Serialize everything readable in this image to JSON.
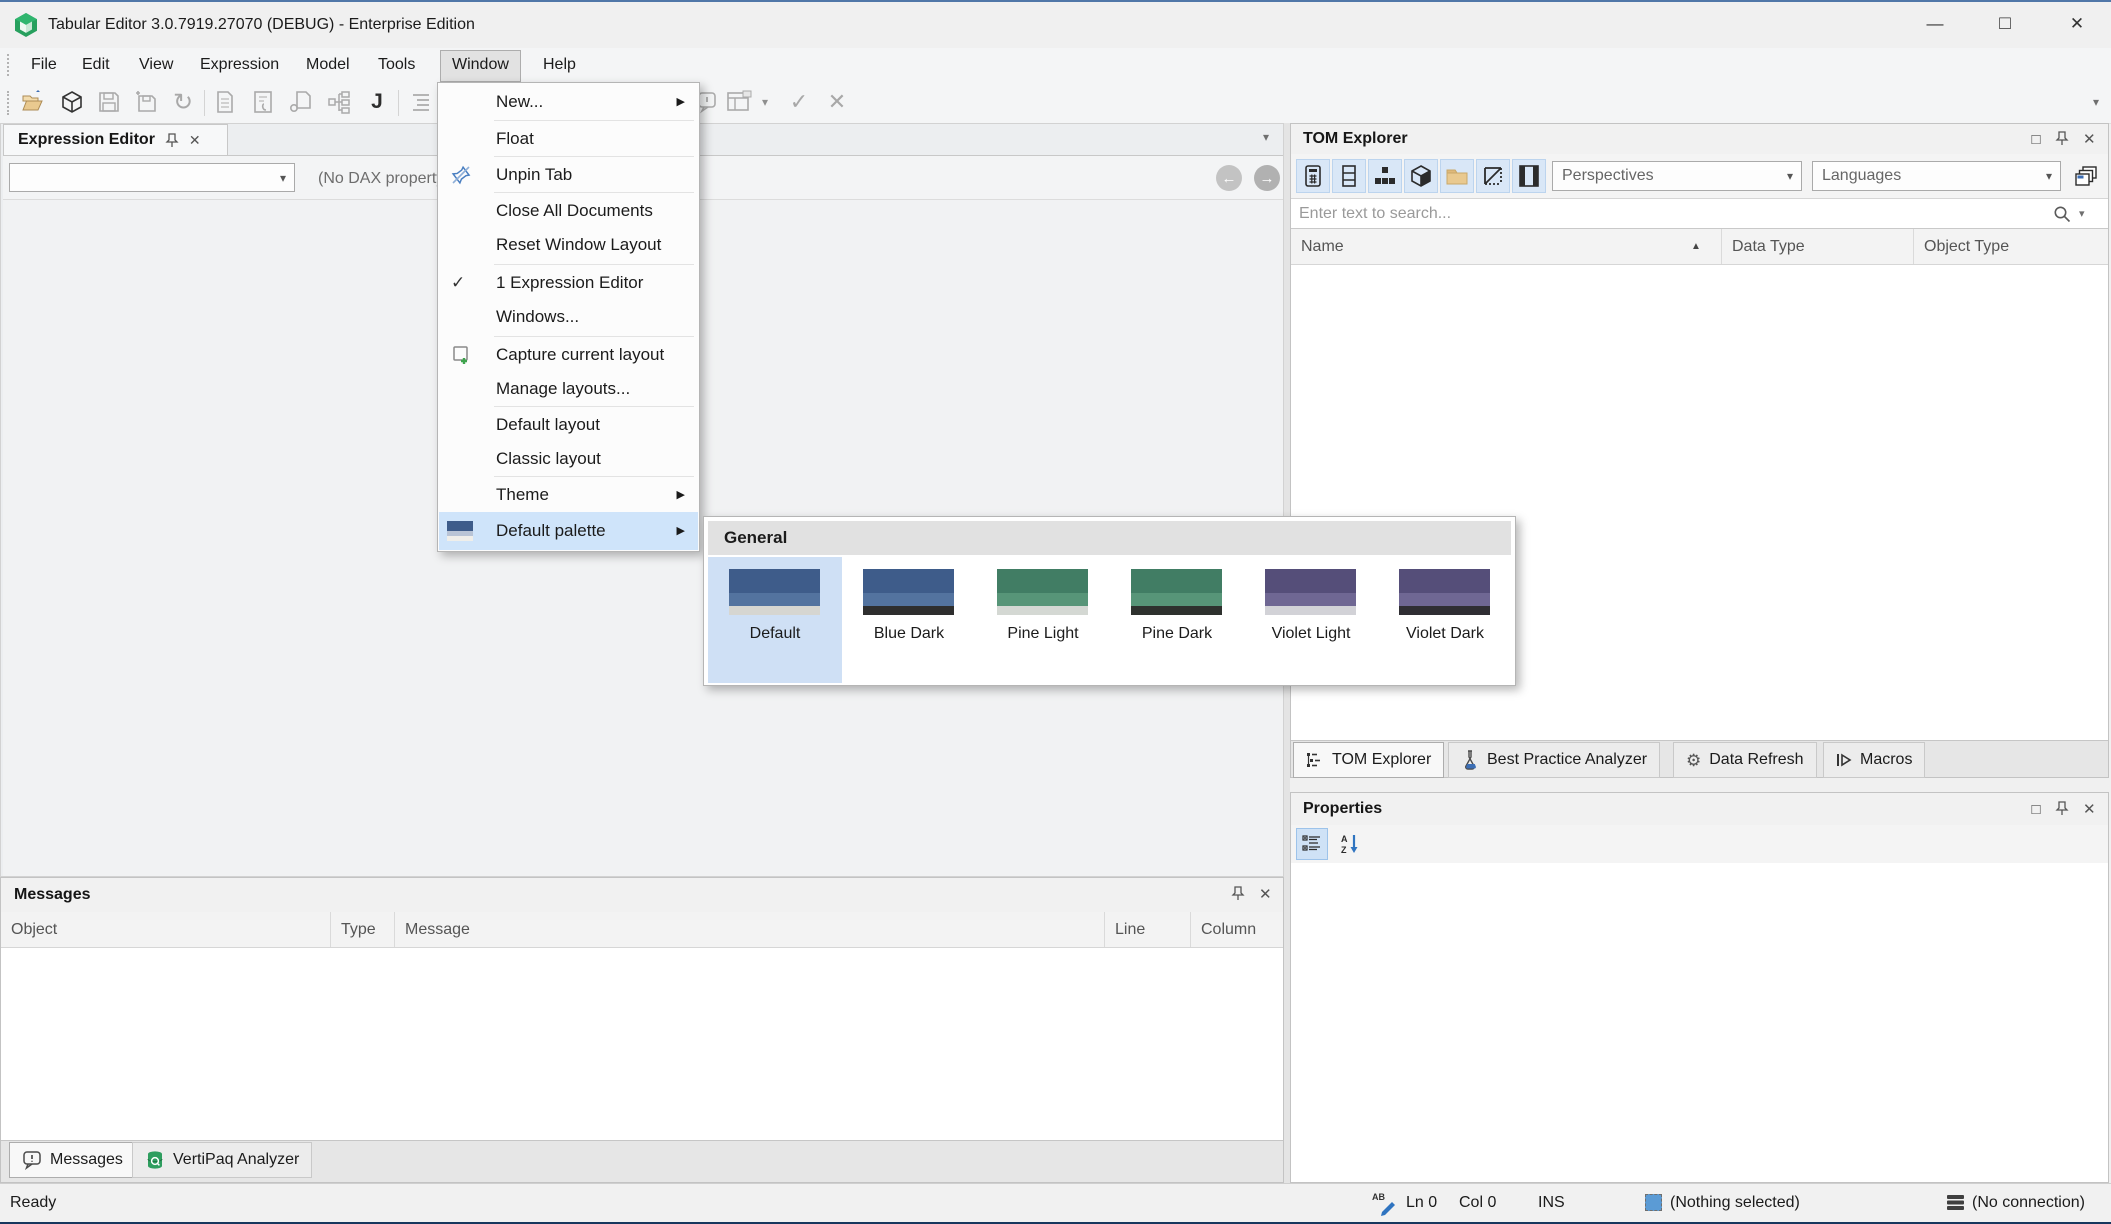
{
  "window": {
    "title": "Tabular Editor 3.0.7919.27070 (DEBUG) - Enterprise Edition"
  },
  "menubar": {
    "items": [
      "File",
      "Edit",
      "View",
      "Expression",
      "Model",
      "Tools",
      "Window",
      "Help"
    ],
    "open_item": "Window"
  },
  "window_menu": {
    "items": [
      {
        "label": "New..."
      },
      {
        "label": "Float"
      },
      {
        "label": "Unpin Tab"
      },
      {
        "label": "Close All Documents"
      },
      {
        "label": "Reset Window Layout"
      },
      {
        "label": "1 Expression Editor"
      },
      {
        "label": "Windows..."
      },
      {
        "label": "Capture current layout"
      },
      {
        "label": "Manage layouts..."
      },
      {
        "label": "Default layout"
      },
      {
        "label": "Classic layout"
      },
      {
        "label": "Theme"
      },
      {
        "label": "Default palette"
      }
    ],
    "highlighted_item": "Default palette",
    "palette_icon_colors": {
      "top": "#3E5C8A",
      "mid": "#B9C4D6",
      "bottom": "#EFEEEA"
    }
  },
  "palette_submenu": {
    "group_label": "General",
    "selected": "Default",
    "items": [
      {
        "label": "Default",
        "colors": {
          "top": "#3E5C8A",
          "mid": "#53739F",
          "bottom": "#D6D6D1"
        }
      },
      {
        "label": "Blue Dark",
        "colors": {
          "top": "#3E5C8A",
          "mid": "#53739F",
          "bottom": "#2E2E2E"
        }
      },
      {
        "label": "Pine Light",
        "colors": {
          "top": "#417D64",
          "mid": "#579578",
          "bottom": "#D4D8D3"
        }
      },
      {
        "label": "Pine Dark",
        "colors": {
          "top": "#417D64",
          "mid": "#579578",
          "bottom": "#2E312E"
        }
      },
      {
        "label": "Violet Light",
        "colors": {
          "top": "#554E79",
          "mid": "#6F6793",
          "bottom": "#D2D2D7"
        }
      },
      {
        "label": "Violet Dark",
        "colors": {
          "top": "#554E79",
          "mid": "#6F6793",
          "bottom": "#2F2E33"
        }
      }
    ]
  },
  "expression_editor": {
    "tab_title": "Expression Editor",
    "dax_status": "(No DAX property selected)",
    "combo_value": ""
  },
  "tom_explorer": {
    "title": "TOM Explorer",
    "perspectives": "Perspectives",
    "languages": "Languages",
    "search_placeholder": "Enter text to search...",
    "columns": [
      "Name",
      "Data Type",
      "Object Type"
    ],
    "tabs": [
      "TOM Explorer",
      "Best Practice Analyzer",
      "Data Refresh",
      "Macros"
    ],
    "active_tab": "TOM Explorer"
  },
  "properties_panel": {
    "title": "Properties"
  },
  "messages_panel": {
    "title": "Messages",
    "columns": [
      "Object",
      "Type",
      "Message",
      "Line",
      "Column"
    ],
    "tabs": [
      "Messages",
      "VertiPaq Analyzer"
    ],
    "active_tab": "Messages"
  },
  "status_bar": {
    "left": "Ready",
    "line": "Ln 0",
    "column": "Col 0",
    "mode": "INS",
    "selection": "(Nothing selected)",
    "connection": "(No connection)"
  },
  "icons": {
    "minimize": "—",
    "restore": "□",
    "close": "✕",
    "check": "✓",
    "submenu_arrow": "▶",
    "dropdown_arrow": "▾",
    "sort_asc": "▲",
    "refresh": "↻",
    "gear": "⚙",
    "back": "←",
    "forward": "→",
    "pencil": "✎",
    "ab": "AB",
    "exclaim": "!"
  },
  "colors": {
    "menu_highlight": "#CFE4FA",
    "selected_cell": "#CFE0F5",
    "titlebar_accent": "#5077A8",
    "toolbar_toggle_bg": "#D9E7F7"
  }
}
